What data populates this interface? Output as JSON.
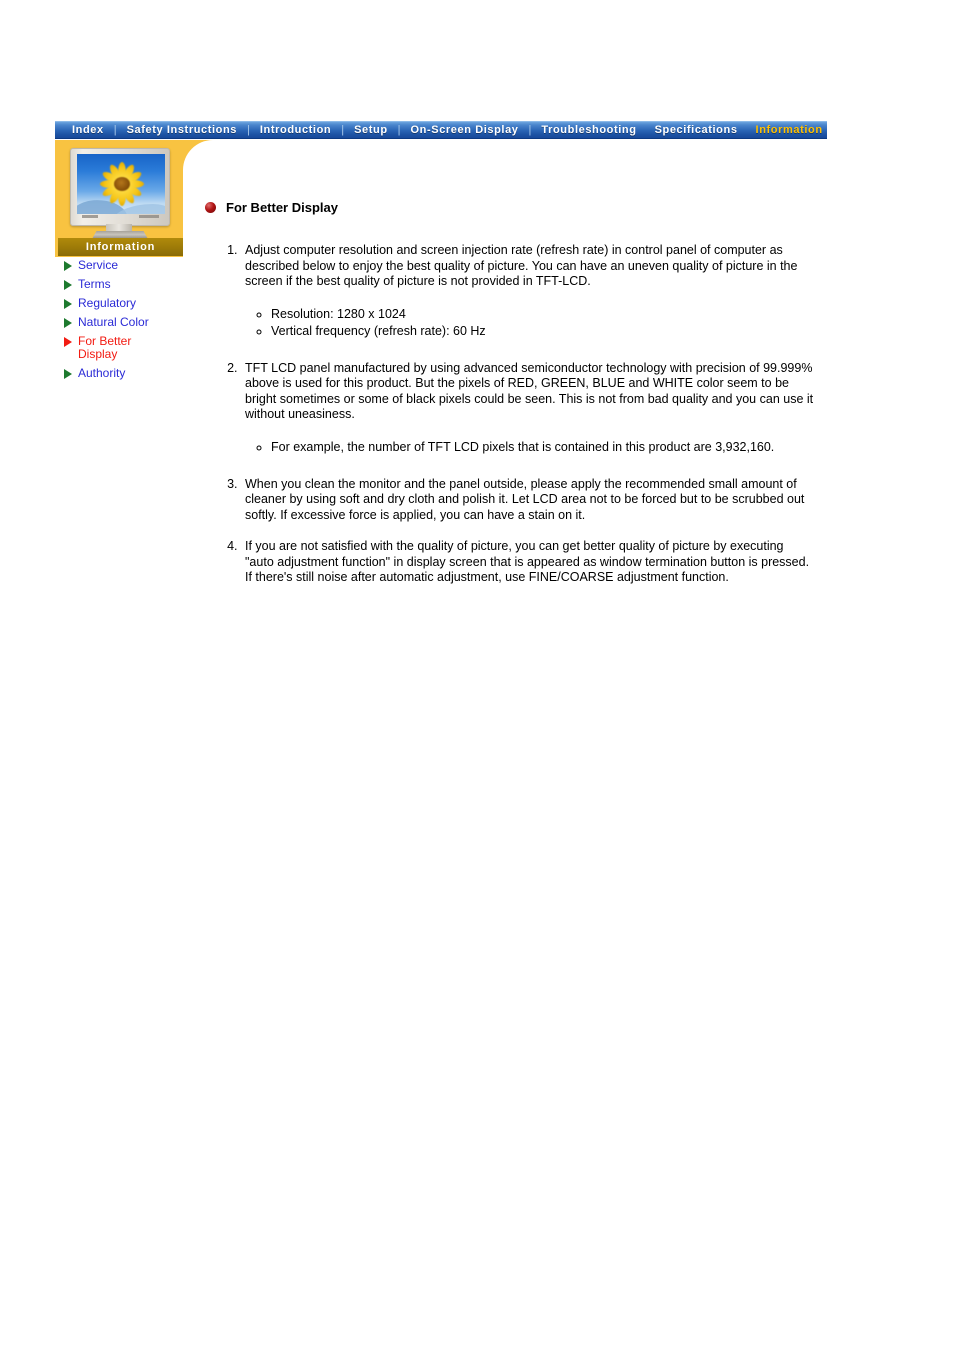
{
  "nav": {
    "items": [
      {
        "label": "Index",
        "active": false
      },
      {
        "label": "Safety Instructions",
        "active": false
      },
      {
        "label": "Introduction",
        "active": false
      },
      {
        "label": "Setup",
        "active": false
      },
      {
        "label": "On-Screen Display",
        "active": false
      },
      {
        "label": "Troubleshooting",
        "active": false
      },
      {
        "label": "Specifications",
        "active": false
      },
      {
        "label": "Information",
        "active": true
      }
    ],
    "separator": "|",
    "accent_color": "#ffc000",
    "bar_color": "#2b66b6"
  },
  "sidebar": {
    "section_label": "Information",
    "section_band_color": "#9c7a08",
    "panel_color": "#f8c341",
    "monitor_icon": "monitor-sunflower-image",
    "items": [
      {
        "label": "Service",
        "active": false
      },
      {
        "label": "Terms",
        "active": false
      },
      {
        "label": "Regulatory",
        "active": false
      },
      {
        "label": "Natural Color",
        "active": false
      },
      {
        "label": "For Better\nDisplay",
        "active": true
      },
      {
        "label": "Authority",
        "active": false
      }
    ],
    "link_color": "#2a2ad6",
    "active_color": "#f21b12",
    "arrow_color": "#1d7a2e"
  },
  "main": {
    "heading": "For Better Display",
    "steps": [
      {
        "text": "Adjust computer resolution and screen injection rate (refresh rate) in control panel of computer as described below to enjoy the best quality of picture. You can have an uneven quality of picture in the screen if the best quality of picture is not provided in TFT-LCD.",
        "sub": [
          "Resolution: 1280 x 1024",
          "Vertical frequency (refresh rate): 60 Hz"
        ]
      },
      {
        "text": "TFT LCD panel manufactured by using advanced semiconductor technology with precision of 99.999% above is used for this product. But the pixels of RED, GREEN, BLUE and WHITE color seem to be bright sometimes or some of black pixels could be seen. This is not from bad quality and you can use it without uneasiness.",
        "sub": [
          "For example, the number of TFT LCD pixels that is contained in this product are 3,932,160."
        ]
      },
      {
        "text": "When you clean the monitor and the panel outside, please apply the recommended small amount of cleaner by using soft and dry cloth and polish it. Let LCD area not to be forced but to be scrubbed out softly. If excessive force is applied, you can have a stain on it.",
        "sub": []
      },
      {
        "text": "If you are not satisfied with the quality of picture, you can get better quality of picture by executing \"auto adjustment function\" in display screen that is appeared as window termination button is pressed. If there's still noise after automatic adjustment, use FINE/COARSE adjustment function.",
        "sub": []
      }
    ]
  }
}
